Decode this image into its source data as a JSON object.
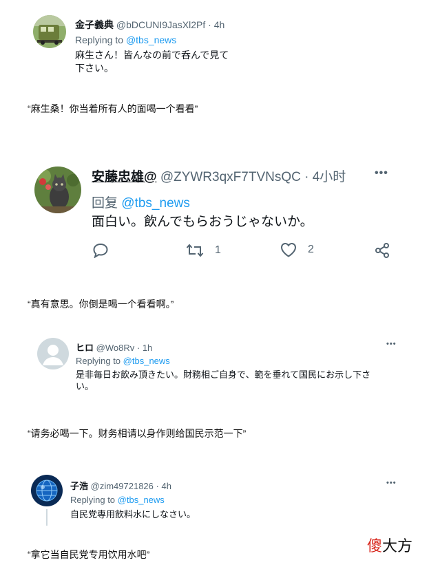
{
  "tweets": [
    {
      "name": "金子義典",
      "handle": "@bDCUNI9JasXl2Pf",
      "sep": "·",
      "time": "4h",
      "replying_prefix": "Replying to",
      "mention": "@tbs_news",
      "text_lines": [
        "麻生さん！皆んなの前で呑んで見て",
        "下さい。"
      ],
      "caption": "“麻生桑！你当着所有人的面喝一个看看”",
      "avatar_icon": "train-photo-avatar"
    },
    {
      "name": "安藤忠雄@",
      "handle": "@ZYWR3qxF7TVNsQC",
      "sep": "·",
      "time": "4小时",
      "replying_prefix": "回复",
      "mention": "@tbs_news",
      "text_lines": [
        "面白い。飲んでもらおうじゃないか。"
      ],
      "more_label": "•••",
      "retweet_count": "1",
      "like_count": "2",
      "caption": "“真有意思。你倒是喝一个看看啊。”",
      "avatar_icon": "cat-photo-avatar"
    },
    {
      "name": "ヒロ",
      "handle": "@Wo8Rv",
      "sep": "·",
      "time": "1h",
      "replying_prefix": "Replying to",
      "mention": "@tbs_news",
      "text_lines": [
        "是非毎日お飲み頂きたい。財務相ご自身で、範を垂れて国民にお示し下さ",
        "い。"
      ],
      "more_label": "•••",
      "caption": "“请务必喝一下。财务相请以身作则给国民示范一下”",
      "avatar_icon": "default-user-avatar"
    },
    {
      "name": "子浩",
      "handle": "@zim49721826",
      "sep": "·",
      "time": "4h",
      "replying_prefix": "Replying to",
      "mention": "@tbs_news",
      "text_lines": [
        "自民党専用飲料水にしなさい。"
      ],
      "more_label": "•••",
      "caption": "“拿它当自民党专用饮用水吧”",
      "avatar_icon": "blue-globe-avatar"
    }
  ],
  "watermark": {
    "part1": "傻",
    "part2": "大方"
  },
  "colors": {
    "link": "#1d9bf0",
    "muted": "#536471",
    "text": "#0f1419",
    "watermark_red": "#d8261c"
  }
}
